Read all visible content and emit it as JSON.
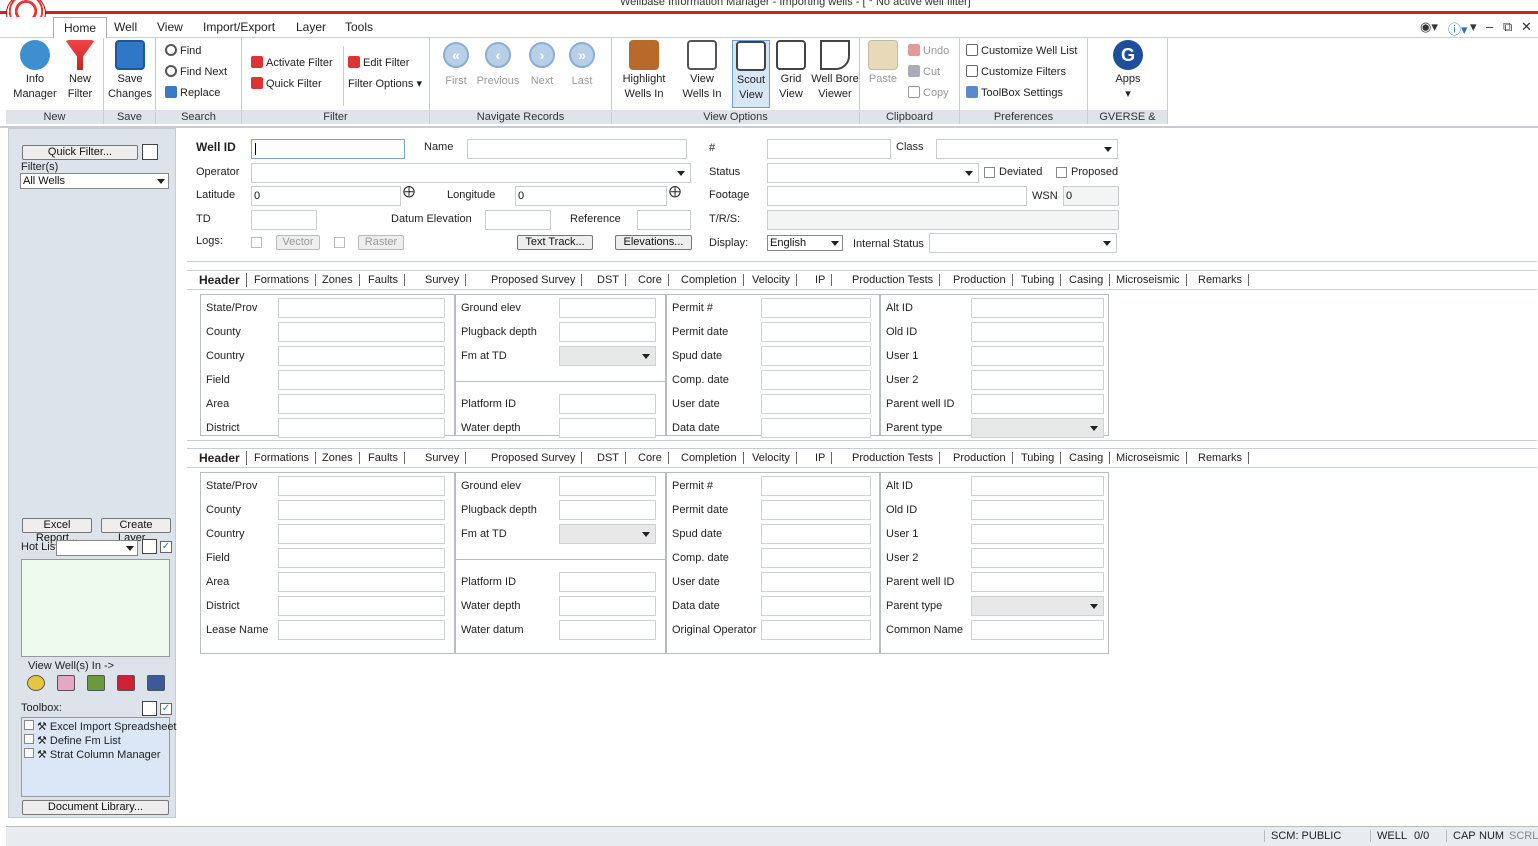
{
  "window": {
    "title": "Wellbase Information Manager - Importing wells - [ * No active well filter]"
  },
  "menu": {
    "items": [
      "Home",
      "Well",
      "View",
      "Import/Export",
      "Layer",
      "Tools"
    ]
  },
  "ribbon": {
    "groups": {
      "new": "New",
      "save": "Save",
      "search": "Search",
      "filter": "Filter",
      "navigate": "Navigate Records",
      "viewoptions": "View Options",
      "clipboard": "Clipboard",
      "preferences": "Preferences",
      "gverse": "GVERSE & GGX"
    },
    "info_manager": "Info\nManager",
    "new_filter": "New\nFilter",
    "save_changes": "Save\nChanges",
    "find": "Find",
    "find_next": "Find Next",
    "replace": "Replace",
    "activate_filter": "Activate Filter",
    "quick_filter": "Quick Filter",
    "edit_filter": "Edit Filter",
    "filter_options": "Filter Options",
    "first": "First",
    "previous": "Previous",
    "next": "Next",
    "last": "Last",
    "highlight": "Highlight\nWells In",
    "view_wells": "View\nWells In",
    "scout_view": "Scout\nView",
    "grid_view": "Grid\nView",
    "well_bore": "Well Bore\nViewer",
    "paste": "Paste",
    "undo": "Undo",
    "cut": "Cut",
    "copy": "Copy",
    "customize_well_list": "Customize Well List",
    "customize_filters": "Customize Filters",
    "toolbox_settings": "ToolBox Settings",
    "apps": "Apps"
  },
  "left": {
    "quick_filter": "Quick Filter...",
    "filters_label": "Filter(s)",
    "filter_value": "All Wells",
    "excel_report": "Excel Report...",
    "create_layer": "Create Layer...",
    "hot_list": "Hot List",
    "view_wells_in": "View Well(s) In ->",
    "toolbox_label": "Toolbox:",
    "toolbox_items": [
      "Excel Import Spreadsheet",
      "Define Fm List",
      "Strat Column Manager"
    ],
    "document_library": "Document Library..."
  },
  "form": {
    "well_id": "Well ID",
    "name": "Name",
    "hash": "#",
    "class": "Class",
    "operator": "Operator",
    "status": "Status",
    "deviated": "Deviated",
    "proposed": "Proposed",
    "latitude": "Latitude",
    "latitude_val": "0",
    "longitude": "Longitude",
    "longitude_val": "0",
    "footage": "Footage",
    "wsn": "WSN",
    "wsn_val": "0",
    "td": "TD",
    "datum_elevation": "Datum Elevation",
    "reference": "Reference",
    "trs": "T/R/S:",
    "logs": "Logs:",
    "vector": "Vector",
    "raster": "Raster",
    "text_track": "Text Track...",
    "elevations": "Elevations...",
    "display": "Display:",
    "display_val": "English",
    "internal_status": "Internal Status"
  },
  "tabs": [
    "Header",
    "Formations",
    "Zones",
    "Faults",
    "Survey",
    "Proposed Survey",
    "DST",
    "Core",
    "Completion",
    "Velocity",
    "IP",
    "Production Tests",
    "Production",
    "Tubing",
    "Casing",
    "Microseismic",
    "Remarks"
  ],
  "panel1": {
    "c1": [
      "State/Prov",
      "County",
      "Country",
      "Field",
      "Area",
      "District"
    ],
    "c2a": [
      "Ground elev",
      "Plugback depth",
      "Fm at TD"
    ],
    "c2b": [
      "Platform ID",
      "Water depth"
    ],
    "c3": [
      "Permit #",
      "Permit date",
      "Spud date",
      "Comp. date",
      "User date",
      "Data date"
    ],
    "c4": [
      "Alt ID",
      "Old ID",
      "User 1",
      "User 2",
      "Parent well ID",
      "Parent type"
    ]
  },
  "panel2": {
    "c1": [
      "State/Prov",
      "County",
      "Country",
      "Field",
      "Area",
      "District",
      "Lease Name"
    ],
    "c2a": [
      "Ground elev",
      "Plugback depth",
      "Fm at TD"
    ],
    "c2b": [
      "Platform ID",
      "Water depth",
      "Water datum"
    ],
    "c3": [
      "Permit #",
      "Permit date",
      "Spud date",
      "Comp. date",
      "User date",
      "Data date",
      "Original Operator"
    ],
    "c4": [
      "Alt ID",
      "Old ID",
      "User 1",
      "User 2",
      "Parent well ID",
      "Parent type",
      "Common Name"
    ]
  },
  "status": {
    "scm": "SCM: PUBLIC",
    "well": "WELL",
    "count": "0/0",
    "cap": "CAP",
    "num": "NUM",
    "scrl": "SCRL"
  }
}
